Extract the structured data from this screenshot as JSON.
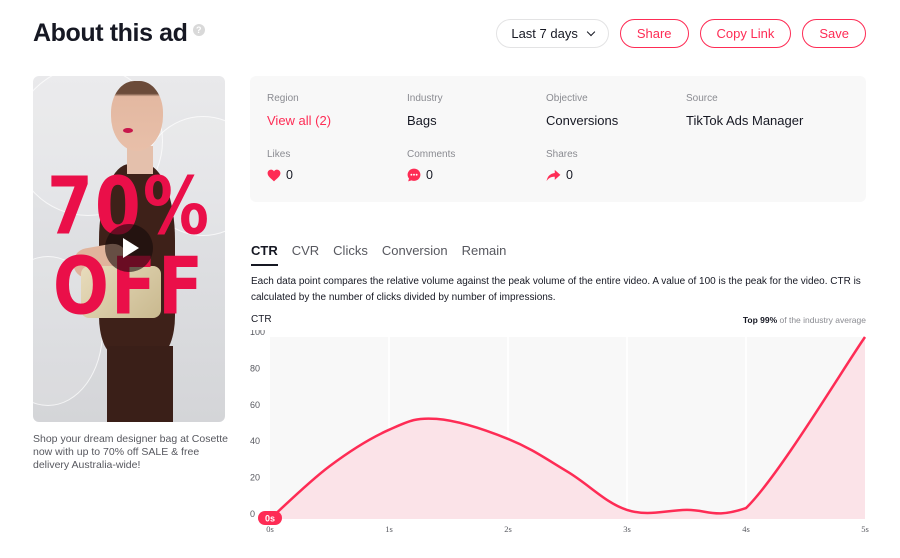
{
  "header": {
    "title": "About this ad",
    "help_icon": "question-circle-icon"
  },
  "toolbar": {
    "date_range": "Last 7 days",
    "date_icon": "chevron-down-icon",
    "share_label": "Share",
    "copy_link_label": "Copy Link",
    "save_label": "Save"
  },
  "video": {
    "promo_line1": "70%",
    "promo_line2": "OFF",
    "play_icon": "play-icon",
    "caption": "Shop your dream designer bag at Cosette now with up to 70% off SALE & free delivery Australia-wide!"
  },
  "info": {
    "region_label": "Region",
    "region_value": "View all (2)",
    "industry_label": "Industry",
    "industry_value": "Bags",
    "objective_label": "Objective",
    "objective_value": "Conversions",
    "source_label": "Source",
    "source_value": "TikTok Ads Manager",
    "likes_label": "Likes",
    "likes_value": "0",
    "likes_icon": "heart-icon",
    "comments_label": "Comments",
    "comments_value": "0",
    "comments_icon": "comment-bubble-icon",
    "shares_label": "Shares",
    "shares_value": "0",
    "shares_icon": "share-arrow-icon"
  },
  "tabs": [
    {
      "label": "CTR",
      "active": true
    },
    {
      "label": "CVR",
      "active": false
    },
    {
      "label": "Clicks",
      "active": false
    },
    {
      "label": "Conversion",
      "active": false
    },
    {
      "label": "Remain",
      "active": false
    }
  ],
  "description": "Each data point compares the relative volume against the peak volume of the entire video. A value of 100 is the peak for the video. CTR is calculated by the number of clicks divided by number of impressions.",
  "industry_note": {
    "bold": "Top 99%",
    "rest": " of the industry average"
  },
  "colors": {
    "accent": "#fe2c55",
    "line": "#fe2c55",
    "area_fill": "#fbe3e8",
    "plot_bg": "#f8f8f8",
    "text": "#161823",
    "muted": "#8a8b91"
  },
  "chart_data": {
    "type": "area",
    "title": "CTR",
    "xlabel": "",
    "ylabel": "CTR",
    "x": [
      0,
      0.5,
      1,
      1.4,
      2,
      2.5,
      3,
      3.5,
      4,
      5
    ],
    "values": [
      0,
      29,
      49,
      55,
      44,
      26,
      5,
      5,
      6,
      100
    ],
    "xticks": [
      0,
      1,
      2,
      3,
      4,
      5
    ],
    "xtick_labels": [
      "0s",
      "1s",
      "2s",
      "3s",
      "4s",
      "5s"
    ],
    "yticks": [
      0,
      20,
      40,
      60,
      80,
      100
    ],
    "ytick_labels": [
      "0",
      "20",
      "40",
      "60",
      "80",
      "100"
    ],
    "xlim": [
      0,
      5
    ],
    "ylim": [
      0,
      100
    ],
    "grid": "vertical",
    "marker_label": "0s",
    "marker_x": 0
  }
}
